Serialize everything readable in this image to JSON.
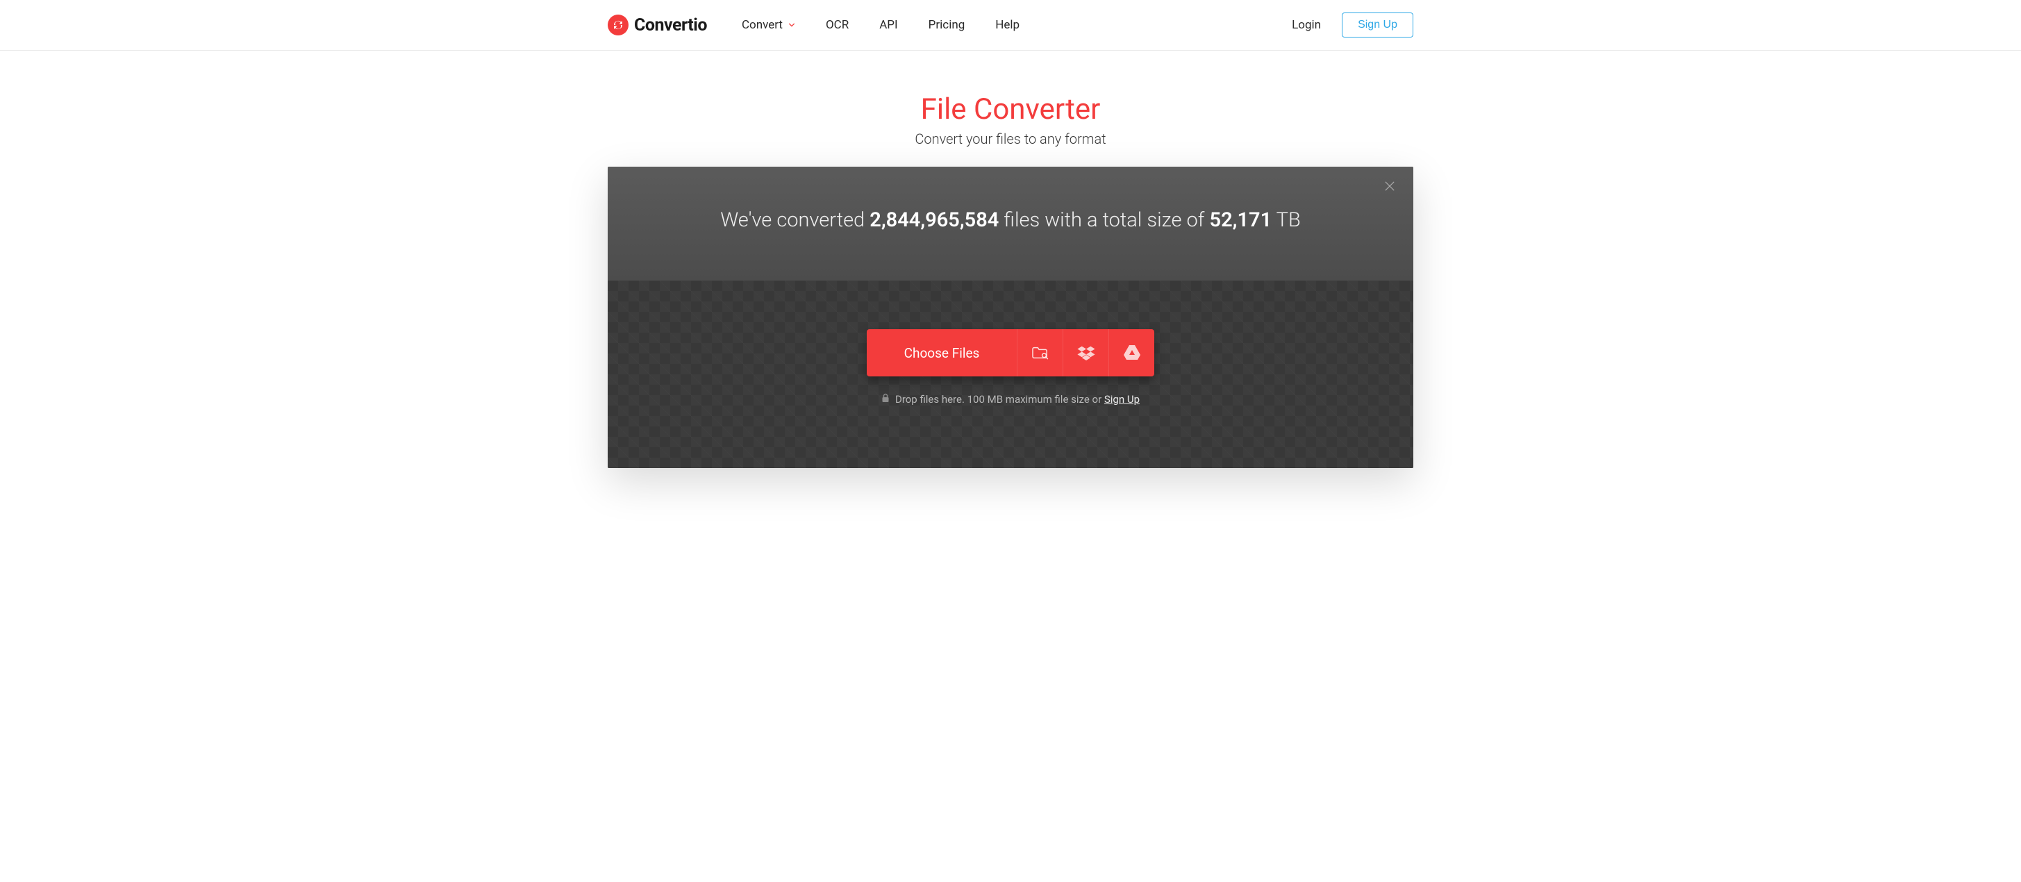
{
  "brand": {
    "name": "Convertio"
  },
  "nav": {
    "convert": "Convert",
    "ocr": "OCR",
    "api": "API",
    "pricing": "Pricing",
    "help": "Help"
  },
  "auth": {
    "login": "Login",
    "signup": "Sign Up"
  },
  "hero": {
    "title": "File Converter",
    "subtitle": "Convert your files to any format"
  },
  "banner": {
    "prefix": "We've converted ",
    "files_count": "2,844,965,584",
    "mid": " files with a total size of ",
    "total_size": "52,171",
    "size_unit": " TB"
  },
  "upload": {
    "choose_label": "Choose Files",
    "hint_prefix": "Drop files here. 100 MB maximum file size or ",
    "hint_link": "Sign Up"
  }
}
